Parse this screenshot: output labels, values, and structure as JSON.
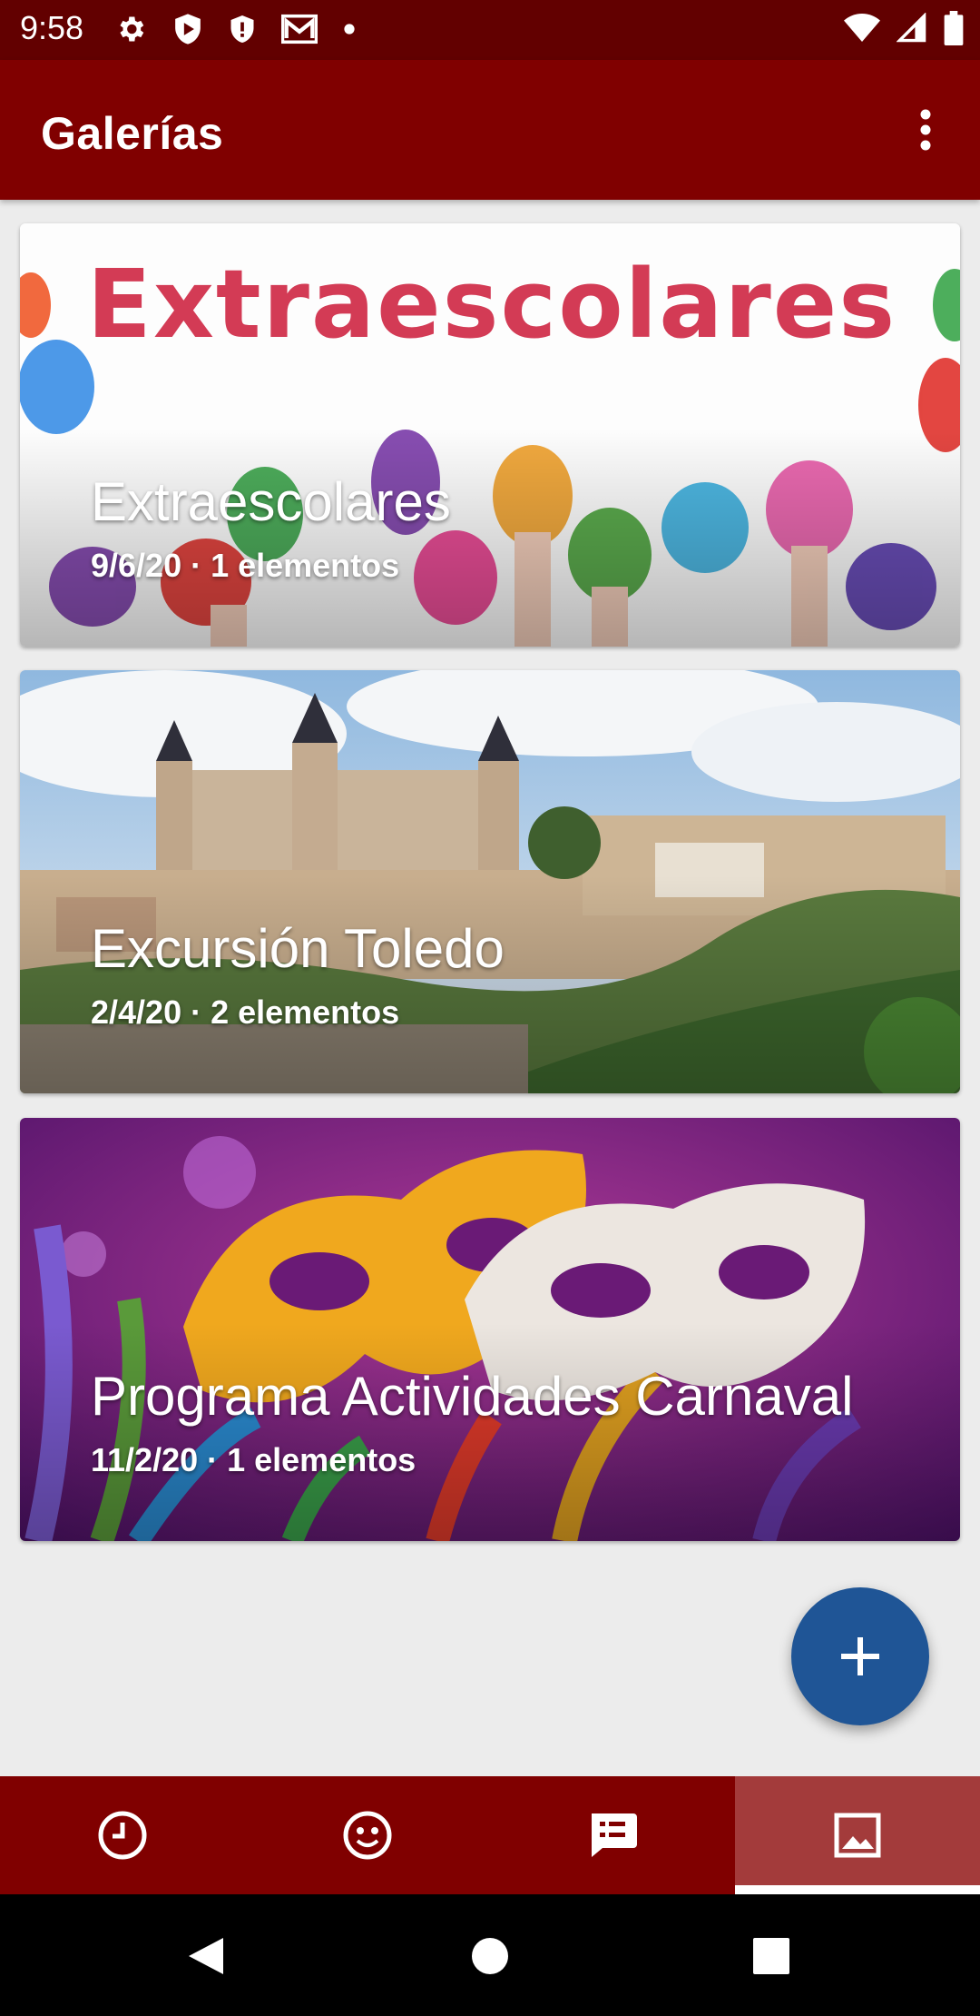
{
  "status_bar": {
    "time": "9:58",
    "icons_left": [
      "gear-icon",
      "play-shield-icon",
      "shield-icon",
      "gmail-icon",
      "dot-icon"
    ],
    "icons_right": [
      "wifi-icon",
      "signal-icon",
      "battery-icon"
    ]
  },
  "app_bar": {
    "title": "Galerías",
    "menu_icon": "more-vert-icon"
  },
  "galleries": [
    {
      "title": "Extraescolares",
      "subtitle": "9/6/20 · 1 elementos",
      "image_text": "Extraescolares"
    },
    {
      "title": "Excursión Toledo",
      "subtitle": "2/4/20 · 2 elementos"
    },
    {
      "title": "Programa Actividades Carnaval",
      "subtitle": "11/2/20 · 1 elementos"
    }
  ],
  "fab": {
    "icon": "plus-icon",
    "color": "#1f5596"
  },
  "bottom_nav": {
    "items": [
      {
        "icon": "clock-icon",
        "active": false
      },
      {
        "icon": "smiley-icon",
        "active": false
      },
      {
        "icon": "chat-icon",
        "active": false
      },
      {
        "icon": "image-icon",
        "active": true
      }
    ],
    "color": "#800000",
    "active_color": "#a33b3b"
  },
  "system_nav": [
    "back-icon",
    "home-icon",
    "recents-icon"
  ]
}
